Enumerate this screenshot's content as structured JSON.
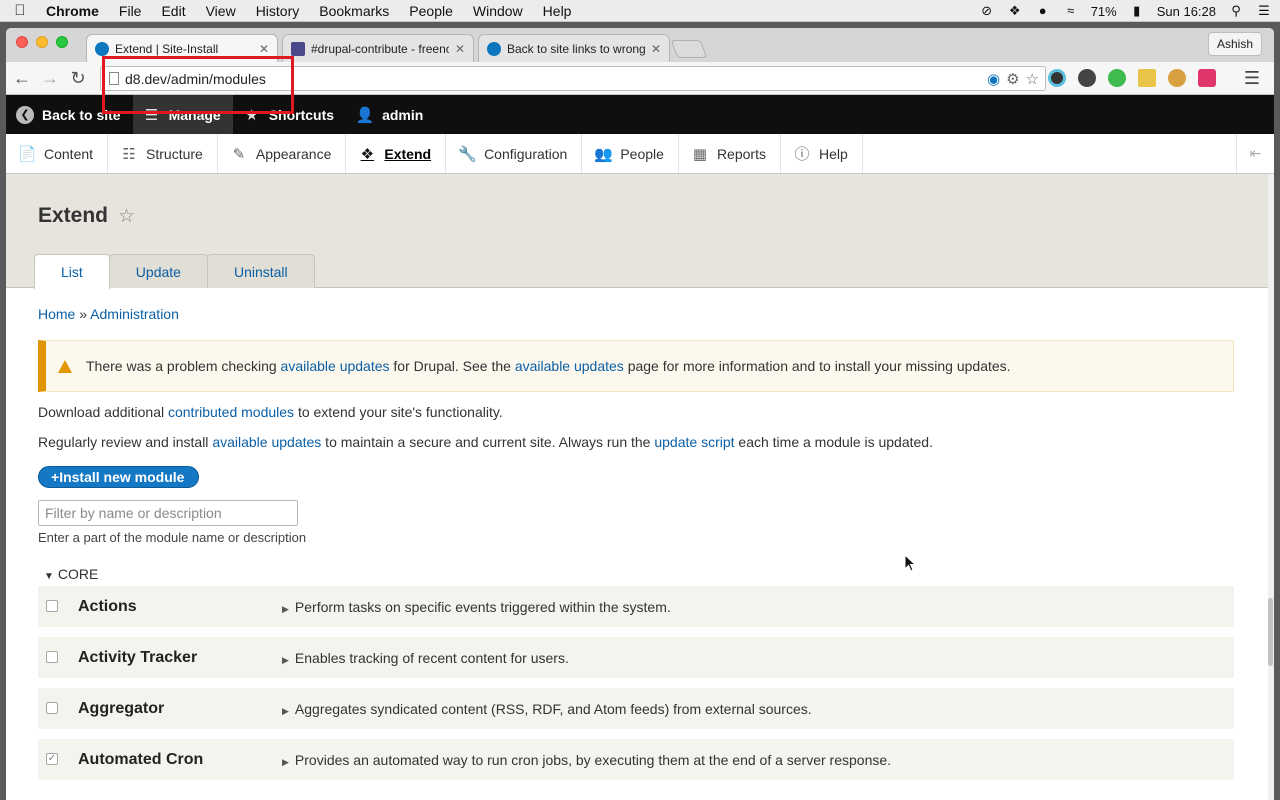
{
  "menubar": {
    "app": "Chrome",
    "items": [
      "File",
      "Edit",
      "View",
      "History",
      "Bookmarks",
      "People",
      "Window",
      "Help"
    ],
    "battery": "71%",
    "clock": "Sun 16:28"
  },
  "browser": {
    "tabs": [
      {
        "title": "Extend | Site-Install",
        "active": true
      },
      {
        "title": "#drupal-contribute - freenc",
        "active": false
      },
      {
        "title": "Back to site links to wrong",
        "active": false
      }
    ],
    "profile": "Ashish",
    "url": "d8.dev/admin/modules"
  },
  "drupal_toolbar": {
    "back": "Back to site",
    "manage": "Manage",
    "shortcuts": "Shortcuts",
    "user": "admin"
  },
  "admin_menu": [
    "Content",
    "Structure",
    "Appearance",
    "Extend",
    "Configuration",
    "People",
    "Reports",
    "Help"
  ],
  "page": {
    "title": "Extend",
    "tabs": [
      "List",
      "Update",
      "Uninstall"
    ],
    "breadcrumb": {
      "home": "Home",
      "sep": "»",
      "admin": "Administration"
    },
    "warning": {
      "t1": "There was a problem checking ",
      "l1": "available updates",
      "t2": " for Drupal. See the ",
      "l2": "available updates",
      "t3": " page for more information and to install your missing updates."
    },
    "para1": {
      "t1": "Download additional ",
      "l1": "contributed modules",
      "t2": " to extend your site's functionality."
    },
    "para2": {
      "t1": "Regularly review and install ",
      "l1": "available updates",
      "t2": " to maintain a secure and current site. Always run the ",
      "l2": "update script",
      "t3": " each time a module is updated."
    },
    "install_button": "Install new module",
    "filter_placeholder": "Filter by name or description",
    "filter_help": "Enter a part of the module name or description",
    "section": "CORE",
    "modules": [
      {
        "name": "Actions",
        "description": "Perform tasks on specific events triggered within the system.",
        "checked": false
      },
      {
        "name": "Activity Tracker",
        "description": "Enables tracking of recent content for users.",
        "checked": false
      },
      {
        "name": "Aggregator",
        "description": "Aggregates syndicated content (RSS, RDF, and Atom feeds) from external sources.",
        "checked": false
      },
      {
        "name": "Automated Cron",
        "description": "Provides an automated way to run cron jobs, by executing them at the end of a server response.",
        "checked": true
      }
    ]
  },
  "colors": {
    "link": "#0b5fa5",
    "warning_border": "#e09600",
    "highlight": "#e0181f",
    "button": "#1478c4"
  }
}
